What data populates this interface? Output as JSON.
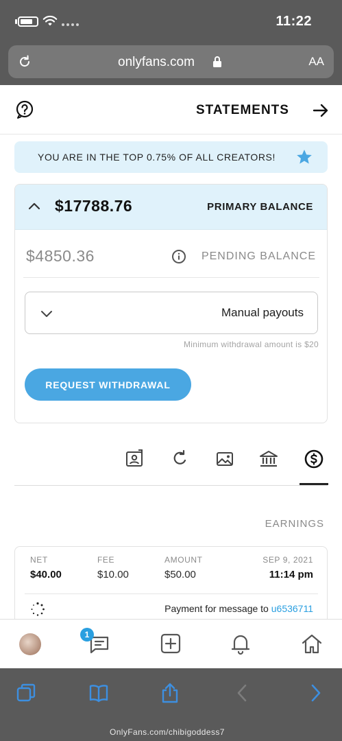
{
  "status_bar": {
    "time": "11:22"
  },
  "browser": {
    "url": "onlyfans.com",
    "text_size_label": "AA"
  },
  "header": {
    "title": "STATEMENTS"
  },
  "banner": {
    "text": "YOU ARE IN THE TOP 0.75% OF ALL CREATORS!"
  },
  "balance": {
    "primary_label": "PRIMARY BALANCE",
    "primary_value": "$17788.76",
    "pending_label": "PENDING BALANCE",
    "pending_value": "$4850.36",
    "payout_mode": "Manual payouts",
    "min_note": "Minimum withdrawal amount is $20",
    "withdraw_label": "REQUEST WITHDRAWAL"
  },
  "tabs": [
    {
      "icon": "dollar-icon",
      "active": true
    },
    {
      "icon": "bank-icon",
      "active": false
    },
    {
      "icon": "image-icon",
      "active": false
    },
    {
      "icon": "refund-icon",
      "active": false
    },
    {
      "icon": "referral-icon",
      "active": false
    }
  ],
  "earnings": {
    "title": "EARNINGS",
    "columns": {
      "date": "SEP 9, 2021",
      "amount": "AMOUNT",
      "fee": "FEE",
      "net": "NET"
    },
    "row": {
      "time": "11:14 pm",
      "amount": "$50.00",
      "fee": "$10.00",
      "net": "$40.00",
      "description": "Payment for message to",
      "user_link": "u6536711"
    }
  },
  "bottom_nav": {
    "message_badge": "1"
  },
  "safari": {
    "home_caption": "OnlyFans.com/chibigoddess7"
  },
  "colors": {
    "accent": "#4aa7e2",
    "banner_bg": "#e0f2fb",
    "chrome": "#5a5a5a"
  }
}
